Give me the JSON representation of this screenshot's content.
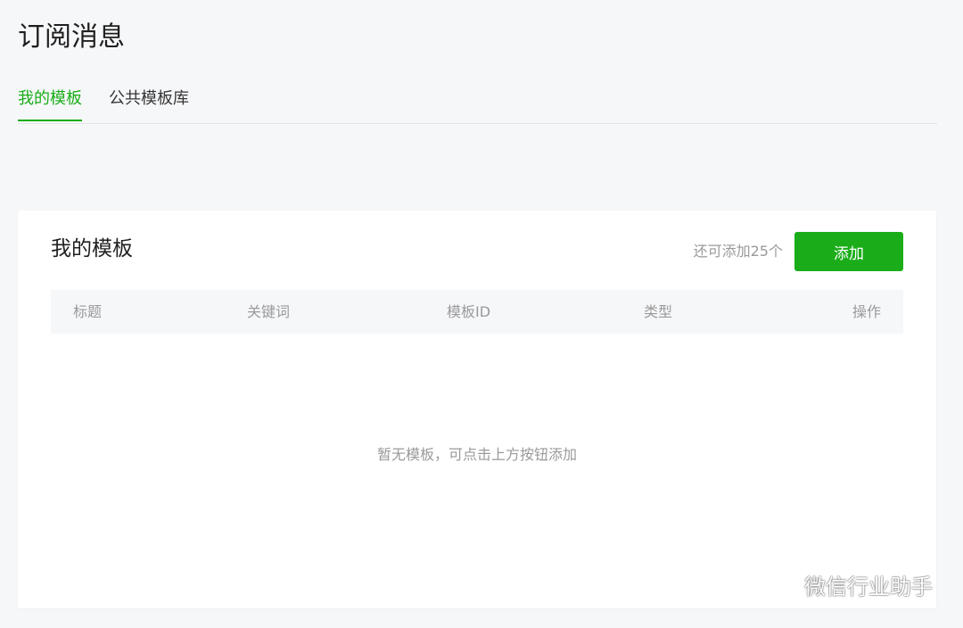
{
  "page": {
    "title": "订阅消息"
  },
  "tabs": [
    {
      "label": "我的模板",
      "active": true
    },
    {
      "label": "公共模板库",
      "active": false
    }
  ],
  "card": {
    "title": "我的模板",
    "remaining_text": "还可添加25个",
    "add_button_label": "添加",
    "table": {
      "columns": [
        "标题",
        "关键词",
        "模板ID",
        "类型",
        "操作"
      ],
      "rows": []
    },
    "empty_text": "暂无模板，可点击上方按钮添加"
  },
  "watermark": {
    "text": "微信行业助手",
    "icon": "wechat-icon"
  },
  "colors": {
    "accent": "#1aad19",
    "background": "#f6f7f9",
    "muted_text": "#9a9a9a"
  }
}
